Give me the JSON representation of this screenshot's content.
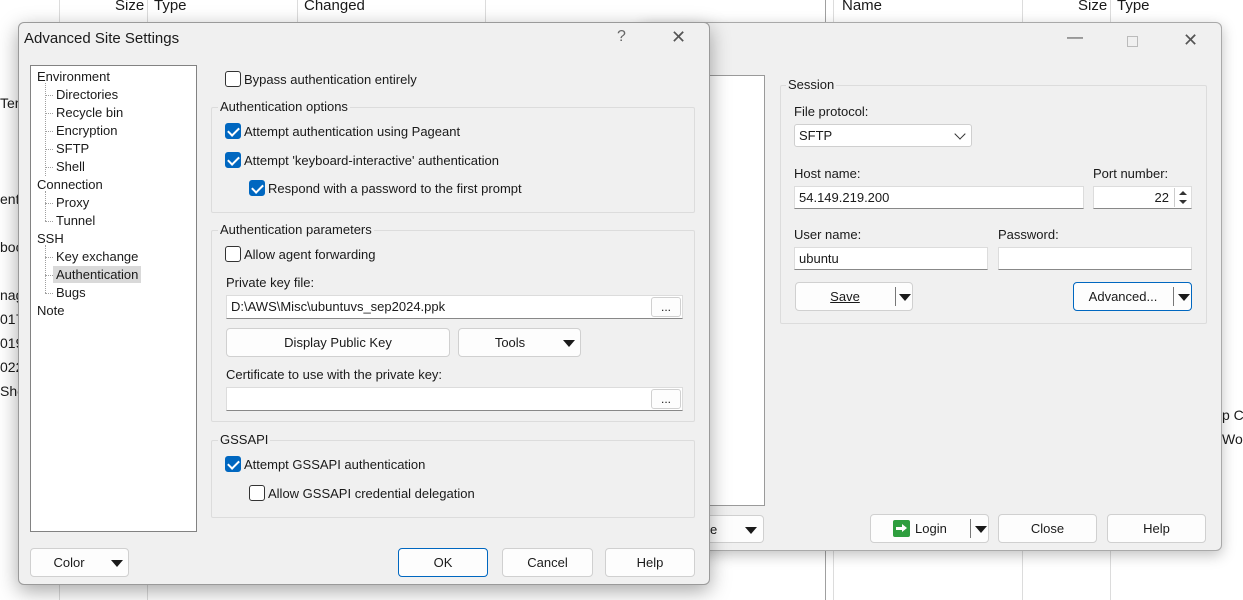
{
  "background": {
    "left_headers": {
      "size": "Size",
      "type": "Type",
      "changed": "Changed"
    },
    "right_headers": {
      "name": "Name",
      "size": "Size",
      "type": "Type"
    },
    "left_fragments": [
      "Tem",
      "ent",
      "boo",
      "nag",
      "017",
      "019",
      "022",
      "She"
    ],
    "right_fragments": [
      "p C.",
      "Wo"
    ]
  },
  "login": {
    "session_title": "Session",
    "file_protocol_label": "File protocol:",
    "file_protocol_value": "SFTP",
    "host_label": "Host name:",
    "host_value": "54.149.219.200",
    "port_label": "Port number:",
    "port_value": "22",
    "user_label": "User name:",
    "user_value": "ubuntu",
    "password_label": "Password:",
    "password_value": "",
    "save_label": "Save",
    "advanced_label": "Advanced...",
    "tools_fragment": "e",
    "login_label": "Login",
    "close_label": "Close",
    "help_label": "Help"
  },
  "dialog": {
    "title": "Advanced Site Settings",
    "help_glyph": "?",
    "close_glyph": "✕",
    "tree": [
      {
        "label": "Environment",
        "level": 0
      },
      {
        "label": "Directories",
        "level": 1
      },
      {
        "label": "Recycle bin",
        "level": 1
      },
      {
        "label": "Encryption",
        "level": 1
      },
      {
        "label": "SFTP",
        "level": 1
      },
      {
        "label": "Shell",
        "level": 1
      },
      {
        "label": "Connection",
        "level": 0
      },
      {
        "label": "Proxy",
        "level": 1
      },
      {
        "label": "Tunnel",
        "level": 1
      },
      {
        "label": "SSH",
        "level": 0
      },
      {
        "label": "Key exchange",
        "level": 1
      },
      {
        "label": "Authentication",
        "level": 1,
        "selected": true
      },
      {
        "label": "Bugs",
        "level": 1
      },
      {
        "label": "Note",
        "level": 0
      }
    ],
    "bypass_label": "Bypass authentication entirely",
    "bypass_checked": false,
    "auth_options_title": "Authentication options",
    "pageant_label": "Attempt authentication using Pageant",
    "pageant_checked": true,
    "kbd_label": "Attempt 'keyboard-interactive' authentication",
    "kbd_checked": true,
    "respond_label": "Respond with a password to the first prompt",
    "respond_checked": true,
    "auth_params_title": "Authentication parameters",
    "agent_fwd_label": "Allow agent forwarding",
    "agent_fwd_checked": false,
    "private_key_label": "Private key file:",
    "private_key_value": "D:\\AWS\\Misc\\ubuntuvs_sep2024.ppk",
    "browse_label": "...",
    "display_key_label": "Display Public Key",
    "tools_label": "Tools",
    "cert_label": "Certificate to use with the private key:",
    "cert_value": "",
    "gssapi_title": "GSSAPI",
    "gssapi_label": "Attempt GSSAPI authentication",
    "gssapi_checked": true,
    "gssapi_deleg_label": "Allow GSSAPI credential delegation",
    "gssapi_deleg_checked": false,
    "color_label": "Color",
    "ok_label": "OK",
    "cancel_label": "Cancel",
    "help_label": "Help"
  },
  "colors": {
    "accent": "#0067c0",
    "dialog_bg": "#f0f0f0",
    "border": "#dcdcdc"
  }
}
